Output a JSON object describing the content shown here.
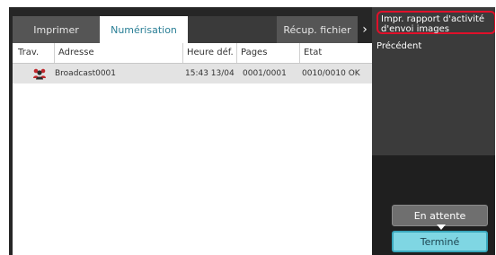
{
  "tabs": [
    {
      "label": "Imprimer"
    },
    {
      "label": "Numérisation"
    },
    {
      "label": "Récup. fichier"
    }
  ],
  "tabs_more_glyph": "›",
  "table": {
    "columns": [
      "Trav.",
      "Adresse",
      "Heure déf.",
      "Pages",
      "Etat"
    ],
    "rows": [
      {
        "job_icon": "broadcast-icon",
        "address": "Broadcast0001",
        "time": "15:43 13/04",
        "pages": "0001/0001",
        "status": "0010/0010 OK"
      }
    ]
  },
  "menu": {
    "items": [
      "Impr. rapport d'activité d'envoi images",
      "Précédent"
    ]
  },
  "buttons": {
    "waiting": "En attente",
    "done": "Terminé"
  },
  "colors": {
    "highlight": "#e0102a",
    "done_button": "#7fd6e3",
    "active_tab_text": "#2a7f96"
  }
}
